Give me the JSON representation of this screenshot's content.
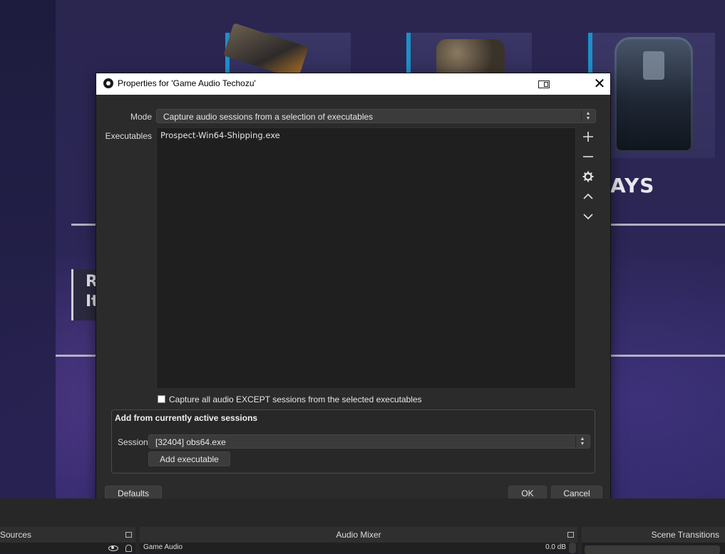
{
  "background": {
    "partial_label": "AYS",
    "panel_text_line1": "R",
    "panel_text_line2": "It"
  },
  "dialog": {
    "title": "Properties for 'Game Audio Techozu'",
    "mode": {
      "label": "Mode",
      "value": "Capture audio sessions from a selection of executables"
    },
    "executables": {
      "label": "Executables",
      "items": [
        "Prospect-Win64-Shipping.exe"
      ],
      "side_buttons": [
        "add-icon",
        "remove-icon",
        "gear-icon",
        "move-up-icon",
        "move-down-icon"
      ]
    },
    "exclude_checkbox": {
      "label": "Capture all audio EXCEPT sessions from the selected executables",
      "checked": false
    },
    "active_sessions": {
      "title": "Add from currently active sessions",
      "session_label": "Session",
      "session_value": "[32404] obs64.exe",
      "add_button": "Add executable"
    },
    "buttons": {
      "defaults": "Defaults",
      "ok": "OK",
      "cancel": "Cancel"
    }
  },
  "docks": {
    "sources_title": "Sources",
    "mixer_title": "Audio Mixer",
    "transitions_title": "Scene Transitions",
    "mixer_source": "Game Audio",
    "mixer_level": "0.0 dB"
  },
  "colors": {
    "dialog_bg": "#2b2b2b",
    "list_bg": "#1f1f1f",
    "accent_cyan": "#1d8fc9"
  }
}
